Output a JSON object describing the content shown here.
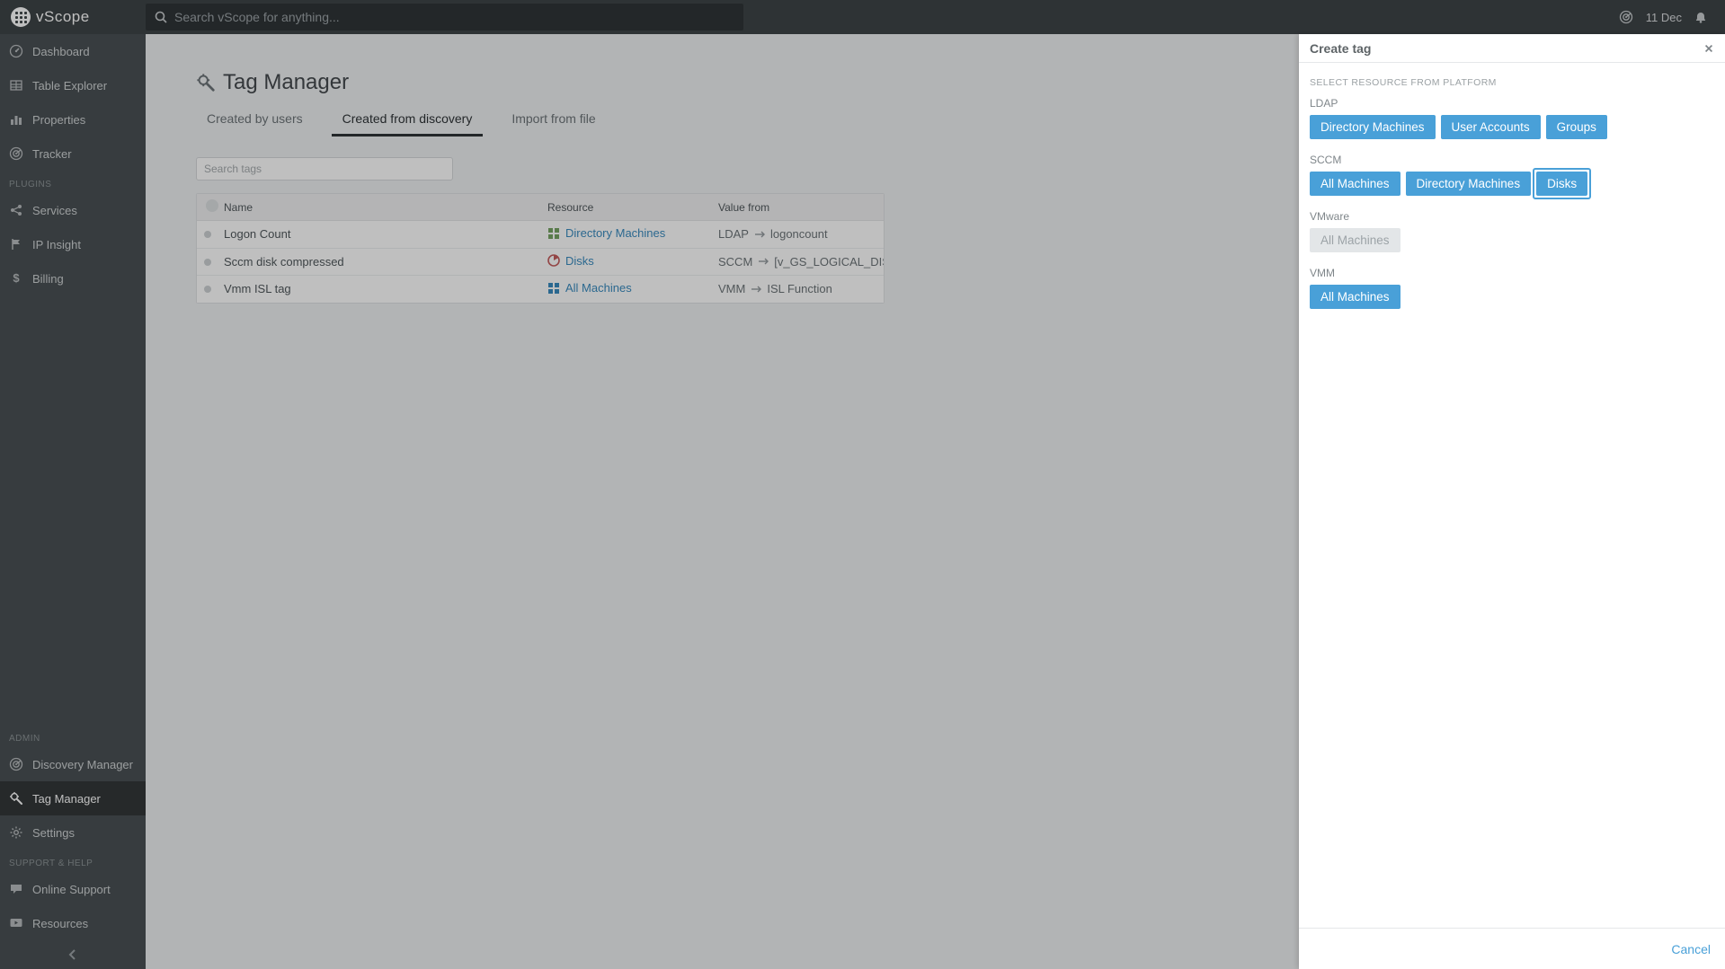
{
  "header": {
    "brand": "vScope",
    "search_placeholder": "Search vScope for anything...",
    "date_label": "11 Dec"
  },
  "sidebar": {
    "nav": [
      {
        "icon": "dashboard",
        "label": "Dashboard"
      },
      {
        "icon": "table",
        "label": "Table Explorer"
      },
      {
        "icon": "barchart",
        "label": "Properties"
      },
      {
        "icon": "radar",
        "label": "Tracker"
      }
    ],
    "plugins_heading": "PLUGINS",
    "plugins": [
      {
        "icon": "share",
        "label": "Services"
      },
      {
        "icon": "flag",
        "label": "IP Insight"
      },
      {
        "icon": "dollar",
        "label": "Billing"
      }
    ],
    "admin_heading": "ADMIN",
    "admin": [
      {
        "icon": "radar",
        "label": "Discovery Manager"
      },
      {
        "icon": "gearwrench",
        "label": "Tag Manager",
        "active": true
      },
      {
        "icon": "gear",
        "label": "Settings"
      }
    ],
    "support_heading": "SUPPORT & HELP",
    "support": [
      {
        "icon": "comment",
        "label": "Online Support"
      },
      {
        "icon": "play",
        "label": "Resources"
      }
    ]
  },
  "page": {
    "title": "Tag Manager",
    "tabs": [
      {
        "label": "Created by users"
      },
      {
        "label": "Created from discovery",
        "active": true
      },
      {
        "label": "Import from file"
      }
    ],
    "search_tags_placeholder": "Search tags",
    "columns": {
      "name": "Name",
      "resource": "Resource",
      "value_from": "Value from"
    },
    "rows": [
      {
        "name": "Logon Count",
        "resource": {
          "icon": "grid-green",
          "label": "Directory Machines"
        },
        "value_from": {
          "platform": "LDAP",
          "target": "logoncount"
        }
      },
      {
        "name": "Sccm disk compressed",
        "resource": {
          "icon": "disk-red",
          "label": "Disks"
        },
        "value_from": {
          "platform": "SCCM",
          "target": "[v_GS_LOGICAL_DISK"
        }
      },
      {
        "name": "Vmm ISL tag",
        "resource": {
          "icon": "grid-blue",
          "label": "All Machines"
        },
        "value_from": {
          "platform": "VMM",
          "target": "ISL Function"
        }
      }
    ]
  },
  "panel": {
    "title": "Create tag",
    "subtitle": "SELECT RESOURCE FROM PLATFORM",
    "groups": [
      {
        "name": "LDAP",
        "chips": [
          {
            "label": "Directory Machines"
          },
          {
            "label": "User Accounts"
          },
          {
            "label": "Groups"
          }
        ]
      },
      {
        "name": "SCCM",
        "chips": [
          {
            "label": "All Machines"
          },
          {
            "label": "Directory Machines"
          },
          {
            "label": "Disks",
            "focus": true
          }
        ]
      },
      {
        "name": "VMware",
        "chips": [
          {
            "label": "All Machines",
            "disabled": true
          }
        ]
      },
      {
        "name": "VMM",
        "chips": [
          {
            "label": "All Machines"
          }
        ]
      }
    ],
    "cancel_label": "Cancel"
  },
  "colors": {
    "accent_blue": "#49A0D8",
    "link_blue": "#3A8BBF",
    "green": "#77A464",
    "red": "#C45C5C"
  }
}
